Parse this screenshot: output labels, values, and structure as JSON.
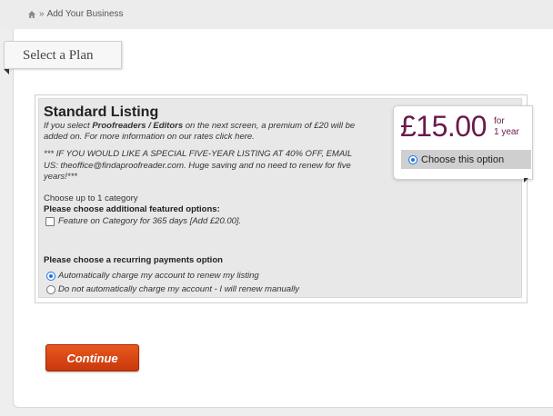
{
  "breadcrumb": {
    "home_icon": "home-icon",
    "separator": "»",
    "current": "Add Your Business"
  },
  "tab": {
    "label": "Select a Plan"
  },
  "plan": {
    "title": "Standard Listing",
    "desc_prefix": "If you select ",
    "desc_bold": "Proofreaders / Editors",
    "desc_middle": " on the next screen, a premium of £20 will be added on. For more information on our rates click ",
    "desc_link": "here",
    "desc_suffix": ".",
    "note": "*** IF YOU WOULD LIKE A SPECIAL FIVE-YEAR LISTING AT 40% OFF, EMAIL US: theoffice@findaproofreader.com. Huge saving and no need to renew for five years!***",
    "choose_category": "Choose up to 1 category",
    "featured_heading": "Please choose additional featured options:",
    "featured_option": "Feature on Category for 365 days [Add £20.00].",
    "featured_checked": false,
    "recurring_heading": "Please choose a recurring payments option",
    "recurring_options": [
      {
        "label": "Automatically charge my account to renew my listing",
        "checked": true
      },
      {
        "label": "Do not automatically charge my account - I will renew manually",
        "checked": false
      }
    ]
  },
  "price_box": {
    "price": "£15.00",
    "period_line1": "for",
    "period_line2": "1 year",
    "choose_label": "Choose this option",
    "price_color": "#6b1a4a"
  },
  "actions": {
    "continue_label": "Continue",
    "button_color": "#d8461a"
  }
}
